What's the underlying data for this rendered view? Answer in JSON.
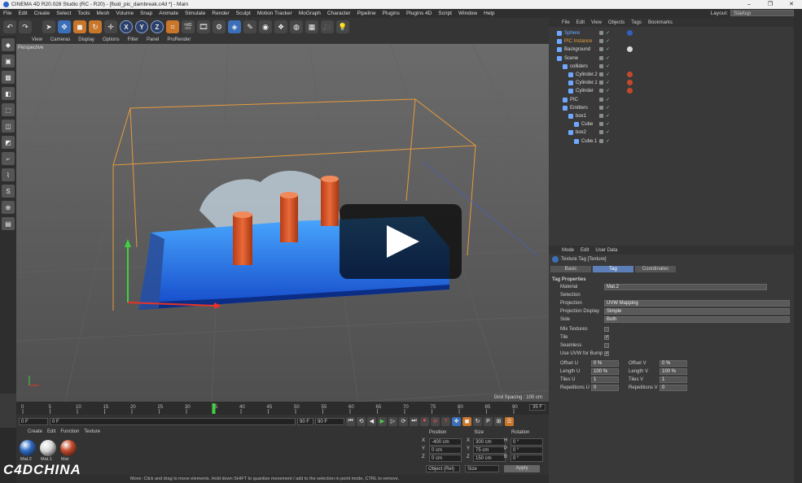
{
  "window": {
    "title": "CINEMA 4D R20.028 Studio (RC - R20) - [fluid_pic_dambreak.c4d *] - Main",
    "layout_label": "Layout:",
    "layout_value": "Startup"
  },
  "menubar": [
    "File",
    "Edit",
    "Create",
    "Select",
    "Tools",
    "Mesh",
    "Volume",
    "Snap",
    "Animate",
    "Simulate",
    "Render",
    "Sculpt",
    "Motion Tracker",
    "MoGraph",
    "Character",
    "Pipeline",
    "Plugins",
    "Plugins 4D",
    "Script",
    "Window",
    "Help"
  ],
  "viewport": {
    "menu": [
      "View",
      "Cameras",
      "Display",
      "Options",
      "Filter",
      "Panel",
      "ProRender"
    ],
    "label": "Perspective",
    "grid_spacing": "Grid Spacing : 100 cm"
  },
  "timeline": {
    "ticks": [
      "0",
      "5",
      "10",
      "15",
      "20",
      "25",
      "30",
      "35",
      "40",
      "45",
      "50",
      "55",
      "60",
      "65",
      "70",
      "75",
      "80",
      "85",
      "90"
    ],
    "current_frame": "35",
    "frame_display": "35 F"
  },
  "transport": {
    "start": "0 F",
    "start2": "0 F",
    "end": "90 F",
    "end2": "90 F"
  },
  "materials": {
    "menu": [
      "Create",
      "Edit",
      "Function",
      "Texture"
    ],
    "items": [
      {
        "name": "Mat.2",
        "color": "#2e6bc4"
      },
      {
        "name": "Mat.1",
        "color": "#d8d8d8"
      },
      {
        "name": "Mat",
        "color": "#c4492b"
      }
    ]
  },
  "coords": {
    "headers": [
      "Position",
      "Size",
      "Rotation"
    ],
    "rows": [
      {
        "a": "X",
        "pos": "-400 cm",
        "b": "X",
        "size": "300 cm",
        "c": "H",
        "rot": "0 °"
      },
      {
        "a": "Y",
        "pos": "0 cm",
        "b": "Y",
        "size": "75 cm",
        "c": "P",
        "rot": "0 °"
      },
      {
        "a": "Z",
        "pos": "0 cm",
        "b": "Z",
        "size": "150 cm",
        "c": "B",
        "rot": "0 °"
      }
    ],
    "mode": "Object (Rel)",
    "size_mode": "Size",
    "apply": "Apply"
  },
  "status": "Move: Click and drag to move elements. Hold down SHIFT to quantize movement / add to the selection in point mode, CTRL to remove.",
  "logo": "C4DCHINA",
  "objects": {
    "menu": [
      "File",
      "Edit",
      "View",
      "Objects",
      "Tags",
      "Bookmarks"
    ],
    "rows": [
      {
        "name": "Sphere",
        "indent": 0,
        "color": "#6fa8ff",
        "tag": "#3060c0"
      },
      {
        "name": "PIC Instance",
        "indent": 0,
        "color": "#e8a03a",
        "tag": ""
      },
      {
        "name": "Background",
        "indent": 0,
        "color": "#dddddd",
        "tag": "#d8d8d8"
      },
      {
        "name": "Scene",
        "indent": 0,
        "color": "#dddddd",
        "tag": ""
      },
      {
        "name": "colliders",
        "indent": 1,
        "color": "#dddddd",
        "tag": ""
      },
      {
        "name": "Cylinder.2",
        "indent": 2,
        "color": "#dddddd",
        "tag": "#c4492b"
      },
      {
        "name": "Cylinder.1",
        "indent": 2,
        "color": "#dddddd",
        "tag": "#c4492b"
      },
      {
        "name": "Cylinder",
        "indent": 2,
        "color": "#dddddd",
        "tag": "#c4492b"
      },
      {
        "name": "PIC",
        "indent": 1,
        "color": "#dddddd",
        "tag": ""
      },
      {
        "name": "Emitters",
        "indent": 1,
        "color": "#dddddd",
        "tag": ""
      },
      {
        "name": "box1",
        "indent": 2,
        "color": "#dddddd",
        "tag": ""
      },
      {
        "name": "Cube",
        "indent": 3,
        "color": "#dddddd",
        "tag": ""
      },
      {
        "name": "box2",
        "indent": 2,
        "color": "#dddddd",
        "tag": ""
      },
      {
        "name": "Cube.1",
        "indent": 3,
        "color": "#dddddd",
        "tag": ""
      }
    ]
  },
  "attributes": {
    "menu": [
      "Mode",
      "Edit",
      "User Data"
    ],
    "title": "Texture Tag [Texture]",
    "tabs": [
      "Basic",
      "Tag",
      "Coordinates"
    ],
    "active_tab": "Tag",
    "section": "Tag Properties",
    "material_label": "Material",
    "material_value": "Mat.2",
    "selection_label": "Selection",
    "projection_label": "Projection",
    "projection_value": "UVW Mapping",
    "projection_display_label": "Projection Display",
    "projection_display_value": "Simple",
    "side_label": "Side",
    "side_value": "Both",
    "mix_textures": "Mix Textures",
    "tile": "Tile",
    "seamless": "Seamless",
    "use_uvw": "Use UVW for Bump",
    "offset_u": "Offset U",
    "offset_u_val": "0 %",
    "offset_v": "Offset V",
    "offset_v_val": "0 %",
    "length_u": "Length U",
    "length_u_val": "100 %",
    "length_v": "Length V",
    "length_v_val": "100 %",
    "tiles_u": "Tiles U",
    "tiles_u_val": "1",
    "tiles_v": "Tiles V",
    "tiles_v_val": "1",
    "rep_u": "Repetitions U",
    "rep_u_val": "0",
    "rep_v": "Repetitions V",
    "rep_v_val": "0"
  }
}
